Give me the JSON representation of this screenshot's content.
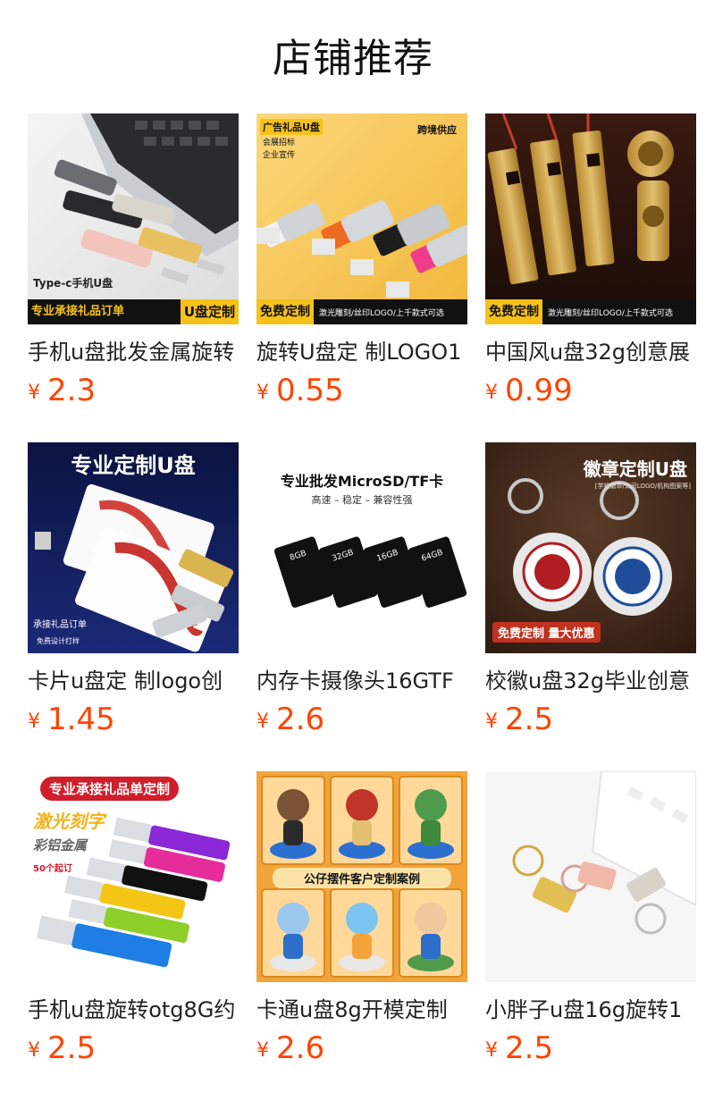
{
  "section": {
    "title": "店铺推荐"
  },
  "currency_symbol": "¥",
  "colors": {
    "price": "#ff4400",
    "title": "#111111",
    "text": "#222222"
  },
  "products": [
    {
      "name": "手机u盘批发金属旋转",
      "price": "2.3",
      "image_texts": {
        "caption": "Type-c手机U盘",
        "band_left": "专业承接礼品订单",
        "band_right": "U盘定制"
      }
    },
    {
      "name": "旋转U盘定 制LOGO1",
      "price": "0.55",
      "image_texts": {
        "tag1": "广告礼品U盘",
        "tag2": "会展招标",
        "tag3": "企业宣传",
        "corner": "跨境供应",
        "band_tag": "免费定制",
        "band_text": "激光雕刻/丝印LOGO/上千款式可选"
      }
    },
    {
      "name": "中国风u盘32g创意展",
      "price": "0.99",
      "image_texts": {
        "band_tag": "免费定制",
        "band_text": "激光雕刻/丝印LOGO/上千款式可选"
      }
    },
    {
      "name": "卡片u盘定 制logo创",
      "price": "1.45",
      "image_texts": {
        "headline": "专业定制U盘",
        "line1": "承接礼品订单",
        "line2": "免费设计打样"
      }
    },
    {
      "name": "内存卡摄像头16GTF",
      "price": "2.6",
      "image_texts": {
        "headline": "专业批发MicroSD/TF卡",
        "sub": "高速 – 稳定 – 兼容性强",
        "cards": [
          "8GB",
          "32GB",
          "16GB",
          "64GB"
        ]
      }
    },
    {
      "name": "校徽u盘32g毕业创意",
      "price": "2.5",
      "image_texts": {
        "headline": "徽章定制U盘",
        "sub": "[学校徽章/公司LOGO/机构图案等]",
        "badge": "免费定制 量大优惠"
      }
    },
    {
      "name": "手机u盘旋转otg8G约",
      "price": "2.5",
      "image_texts": {
        "banner": "专业承接礼品单定制",
        "line1": "激光刻字",
        "line2": "彩铝金属",
        "line3": "50个起订"
      }
    },
    {
      "name": "卡通u盘8g开模定制",
      "price": "2.6",
      "image_texts": {
        "banner": "公仔摆件客户定制案例"
      }
    },
    {
      "name": "小胖子u盘16g旋转1",
      "price": "2.5",
      "image_texts": {}
    }
  ]
}
